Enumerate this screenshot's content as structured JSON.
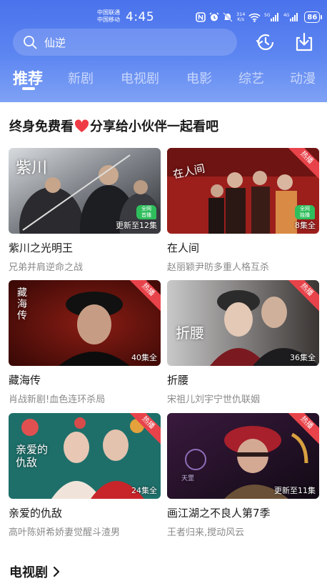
{
  "status": {
    "carrier_1": "中国联通",
    "carrier_2": "中国移动",
    "time": "4:45",
    "net_speed_value": "314",
    "net_speed_unit": "K/s",
    "battery": "86"
  },
  "search": {
    "query": "仙逆"
  },
  "tabs": [
    {
      "label": "推荐",
      "active": true
    },
    {
      "label": "新剧"
    },
    {
      "label": "电视剧"
    },
    {
      "label": "电影"
    },
    {
      "label": "综艺"
    },
    {
      "label": "动漫"
    }
  ],
  "section": {
    "title_before": "终身免费看",
    "title_after": "分享给小伙伴一起看吧"
  },
  "cards": [
    {
      "title": "紫川之光明王",
      "subtitle": "兄弟并肩逆命之战",
      "episodes": "更新至12集",
      "badge": "全网\n首播",
      "poster_text": "紫川"
    },
    {
      "title": "在人间",
      "subtitle": "赵丽颖尹昉多重人格互杀",
      "episodes": "8集全",
      "hot": "热播",
      "badge": "全网\n独播",
      "poster_text": "在人间"
    },
    {
      "title": "藏海传",
      "subtitle": "肖战新剧!血色连环杀局",
      "episodes": "40集全",
      "hot": "热播",
      "poster_text": "藏海传"
    },
    {
      "title": "折腰",
      "subtitle": "宋祖儿刘宇宁世仇联姻",
      "episodes": "36集全",
      "hot": "热播",
      "poster_text": "折腰"
    },
    {
      "title": "亲爱的仇敌",
      "subtitle": "高叶陈妍希娇妻觉醒斗渣男",
      "episodes": "24集全",
      "hot": "热播",
      "poster_text": "亲爱的仇敌"
    },
    {
      "title": "画江湖之不良人第7季",
      "subtitle": "王者归来,搅动风云",
      "episodes": "更新至11集",
      "hot": "热播",
      "poster_text": "天罡"
    }
  ],
  "tv_section": {
    "title": "电视剧"
  },
  "colors": {
    "header_top": "#4a72ec",
    "header_bottom": "#7fa2f5",
    "hot_badge": "#e8434a",
    "heart": "#ef3b45"
  }
}
